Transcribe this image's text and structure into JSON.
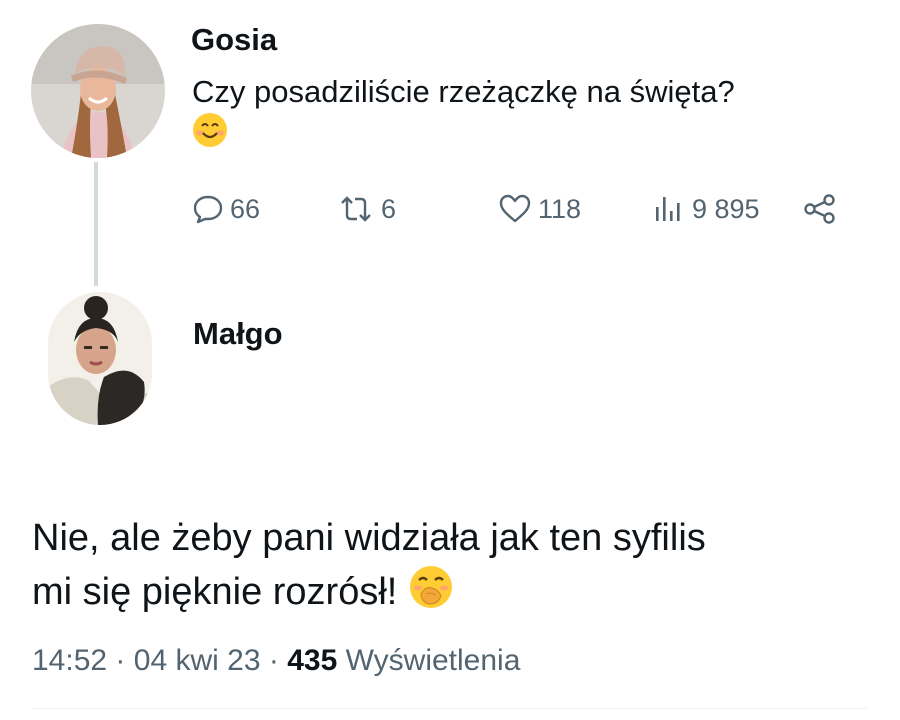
{
  "post": {
    "author": "Gosia",
    "text": "Czy posadziliście rzeżączkę na święta?",
    "emoji": "smiling-face-emoji",
    "stats": {
      "replies": "66",
      "reposts": "6",
      "likes": "118",
      "views": "9 895"
    }
  },
  "reply": {
    "author": "Małgo",
    "text_line1": "Nie, ale żeby pani widziała jak ten syfilis",
    "text_line2": "mi się pięknie rozrósł!",
    "emoji": "face-with-hand-over-mouth-emoji",
    "time": "14:52",
    "date": "04 kwi 23",
    "views_count": "435",
    "views_label": "Wyświetlenia",
    "separator": "·"
  },
  "colors": {
    "text": "#0f1419",
    "muted": "#536471",
    "thread_line": "#cfd9de"
  }
}
